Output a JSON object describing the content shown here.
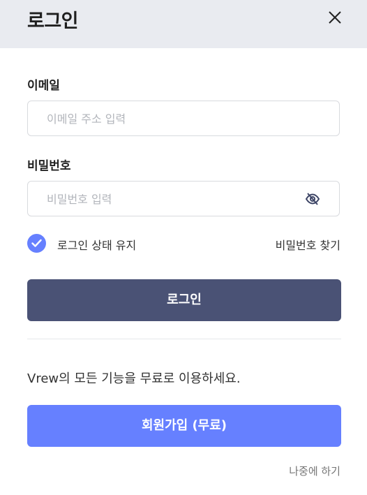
{
  "header": {
    "title": "로그인",
    "close_icon": "close-icon"
  },
  "email": {
    "label": "이메일",
    "placeholder": "이메일 주소 입력",
    "value": ""
  },
  "password": {
    "label": "비밀번호",
    "placeholder": "비밀번호 입력",
    "value": "",
    "toggle_icon": "eye-slash-icon"
  },
  "options": {
    "keep_logged_in": "로그인 상태 유지",
    "keep_checked": true,
    "find_password": "비밀번호 찾기"
  },
  "login_button": "로그인",
  "promo_text": "Vrew의 모든 기능을 무료로 이용하세요.",
  "signup_button": "회원가입 (무료)",
  "later_link": "나중에 하기",
  "colors": {
    "header_bg": "#e9ebf0",
    "login_btn": "#4a5275",
    "signup_btn": "#6680ff",
    "check": "#6680ff"
  }
}
